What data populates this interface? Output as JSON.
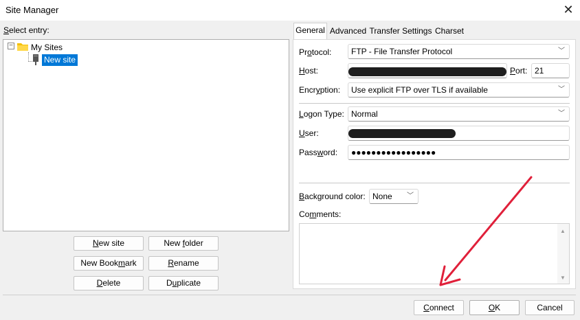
{
  "window": {
    "title": "Site Manager",
    "close_glyph": "✕"
  },
  "select_entry_label": "Select entry:",
  "tree": {
    "root": {
      "label": "My Sites",
      "icon": "folder-icon",
      "expander": "⊟"
    },
    "child": {
      "label": "New site",
      "icon": "server-icon",
      "selected": true
    }
  },
  "left_buttons": {
    "new_site": "New site",
    "new_folder": "New folder",
    "new_bookmark": "New Bookmark",
    "rename": "Rename",
    "delete": "Delete",
    "duplicate": "Duplicate"
  },
  "tabs": [
    "General",
    "Advanced",
    "Transfer Settings",
    "Charset"
  ],
  "active_tab": "General",
  "general": {
    "protocol_label": "Protocol:",
    "protocol_value": "FTP - File Transfer Protocol",
    "host_label": "Host:",
    "port_label": "Port:",
    "port_value": "21",
    "encryption_label": "Encryption:",
    "encryption_value": "Use explicit FTP over TLS if available",
    "logon_type_label": "Logon Type:",
    "logon_type_value": "Normal",
    "user_label": "User:",
    "password_label": "Password:",
    "password_value": "●●●●●●●●●●●●●●●●●",
    "background_color_label": "Background color:",
    "background_color_value": "None",
    "comments_label": "Comments:"
  },
  "bottom_buttons": {
    "connect": "Connect",
    "ok": "OK",
    "cancel": "Cancel"
  },
  "colors": {
    "selection": "#0078d7",
    "arrow": "#e0203a",
    "folder": "#f5c000"
  }
}
